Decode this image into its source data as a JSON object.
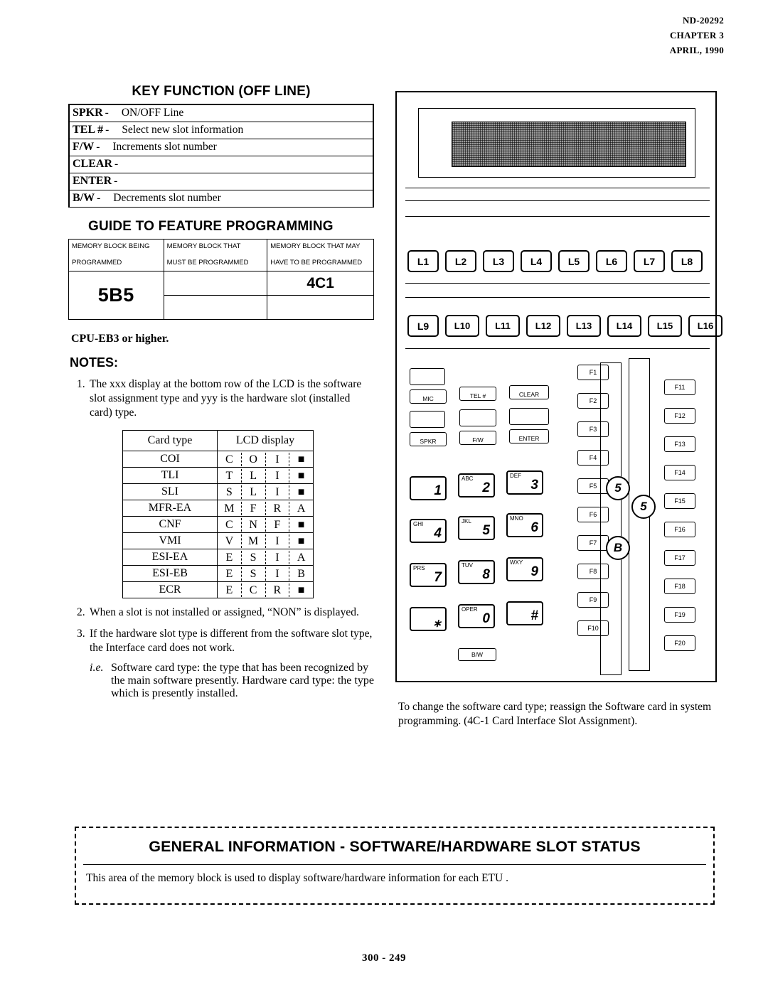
{
  "header": {
    "doc_number": "ND-20292",
    "chapter": "CHAPTER 3",
    "date": "APRIL, 1990"
  },
  "key_function": {
    "title": "KEY FUNCTION (OFF LINE)",
    "rows": [
      {
        "key": "SPKR",
        "dash": "-",
        "desc": "ON/OFF Line"
      },
      {
        "key": "TEL #",
        "dash": "-",
        "desc": "Select new slot information"
      },
      {
        "key": "F/W",
        "dash": "-",
        "desc": "Increments slot number"
      },
      {
        "key": "CLEAR",
        "dash": "-",
        "desc": ""
      },
      {
        "key": "ENTER",
        "dash": "-",
        "desc": ""
      },
      {
        "key": "B/W",
        "dash": "-",
        "desc": "Decrements slot number"
      }
    ]
  },
  "guide": {
    "title": "GUIDE TO FEATURE PROGRAMMING",
    "headers": [
      "MEMORY BLOCK BEING PROGRAMMED",
      "MEMORY BLOCK THAT MUST BE PROGRAMMED",
      "MEMORY BLOCK THAT MAY HAVE TO BE PROGRAMMED"
    ],
    "header_line1": [
      "MEMORY BLOCK BEING",
      "MEMORY BLOCK THAT",
      "MEMORY BLOCK THAT MAY"
    ],
    "header_line2": [
      "PROGRAMMED",
      "MUST BE PROGRAMMED",
      "HAVE TO BE PROGRAMMED"
    ],
    "block": "5B5",
    "must": "",
    "may": "4C1"
  },
  "cpu_note": "CPU-EB3 or higher.",
  "notes_label": "NOTES:",
  "notes": [
    {
      "num": "1.",
      "text": "The xxx display at the bottom row of the LCD is the software slot assignment type and yyy is the hardware slot (installed card) type."
    },
    {
      "num": "2.",
      "text": "When a slot is not installed or assigned, “NON” is displayed."
    },
    {
      "num": "3.",
      "text": "If the hardware slot type is different from the software slot type, the Interface card does not work."
    }
  ],
  "note3_sub": {
    "marker": "i.e.",
    "text": "Software card type:  the type that has been recognized by the main software presently. Hardware card type:  the type which is presently installed."
  },
  "card_table": {
    "headers": [
      "Card type",
      "LCD display"
    ],
    "rows": [
      {
        "name": "COI",
        "lcd": [
          "C",
          "O",
          "I",
          "■"
        ]
      },
      {
        "name": "TLI",
        "lcd": [
          "T",
          "L",
          "I",
          "■"
        ]
      },
      {
        "name": "SLI",
        "lcd": [
          "S",
          "L",
          "I",
          "■"
        ]
      },
      {
        "name": "MFR-EA",
        "lcd": [
          "M",
          "F",
          "R",
          "A"
        ]
      },
      {
        "name": "CNF",
        "lcd": [
          "C",
          "N",
          "F",
          "■"
        ]
      },
      {
        "name": "VMI",
        "lcd": [
          "V",
          "M",
          "I",
          "■"
        ]
      },
      {
        "name": "ESI-EA",
        "lcd": [
          "E",
          "S",
          "I",
          "A"
        ]
      },
      {
        "name": "ESI-EB",
        "lcd": [
          "E",
          "S",
          "I",
          "B"
        ]
      },
      {
        "name": "ECR",
        "lcd": [
          "E",
          "C",
          "R",
          "■"
        ]
      }
    ]
  },
  "phone": {
    "line_keys_row1": [
      "L1",
      "L2",
      "L3",
      "L4",
      "L5",
      "L6",
      "L7",
      "L8"
    ],
    "line_keys_row2": [
      "L9",
      "L10",
      "L11",
      "L12",
      "L13",
      "L14",
      "L15",
      "L16"
    ],
    "feature_keys": [
      "MIC",
      "TEL #",
      "CLEAR",
      "SPKR",
      "F/W",
      "ENTER",
      "B/W"
    ],
    "dial_keys": [
      {
        "letters": "",
        "digit": "1"
      },
      {
        "letters": "ABC",
        "digit": "2"
      },
      {
        "letters": "DEF",
        "digit": "3"
      },
      {
        "letters": "GHI",
        "digit": "4"
      },
      {
        "letters": "JKL",
        "digit": "5"
      },
      {
        "letters": "MNO",
        "digit": "6"
      },
      {
        "letters": "PRS",
        "digit": "7"
      },
      {
        "letters": "TUV",
        "digit": "8"
      },
      {
        "letters": "WXY",
        "digit": "9"
      },
      {
        "letters": "",
        "digit": "∗"
      },
      {
        "letters": "OPER",
        "digit": "0"
      },
      {
        "letters": "",
        "digit": "#"
      }
    ],
    "f_keys_left": [
      "F1",
      "F2",
      "F3",
      "F4",
      "F5",
      "F6",
      "F7",
      "F8",
      "F9",
      "F10"
    ],
    "f_keys_right": [
      "F11",
      "F12",
      "F13",
      "F14",
      "F15",
      "F16",
      "F17",
      "F18",
      "F19",
      "F20"
    ],
    "callouts": [
      "5",
      "5",
      "B"
    ]
  },
  "right_text": "To change the software card type;  reassign the Software card in system programming.  (4C-1 Card Interface Slot Assignment).",
  "banner": {
    "title": "GENERAL INFORMATION  -  SOFTWARE/HARDWARE SLOT STATUS",
    "body": "This area of the memory block is used to display software/hardware information for each ETU ."
  },
  "page_number": "300 - 249"
}
